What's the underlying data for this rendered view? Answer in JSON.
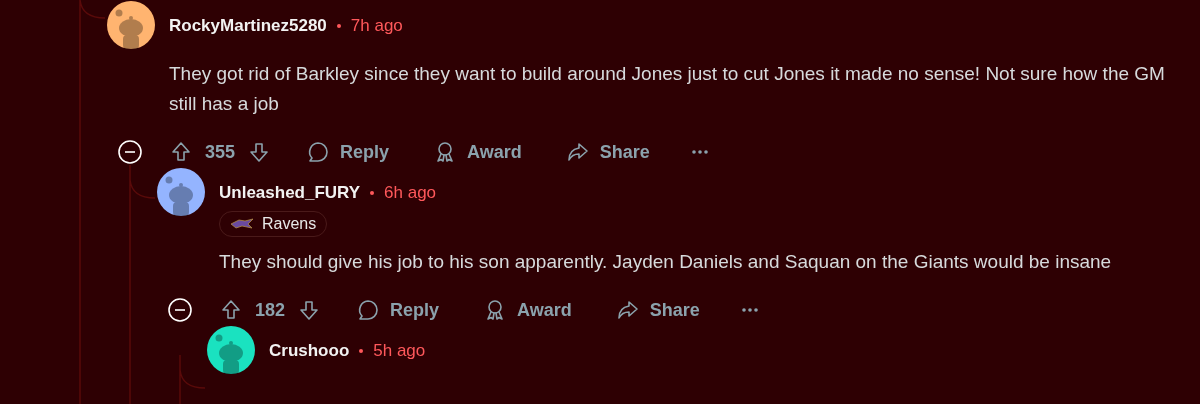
{
  "comments": [
    {
      "author": "RockyMartinez5280",
      "time": "7h ago",
      "color": "#ffb470",
      "body": "They got rid of Barkley since they want to build around Jones just to cut Jones it made no sense! Not sure how the GM still has a job",
      "score": "355",
      "actions": [
        "Reply",
        "Award",
        "Share"
      ],
      "children": [
        {
          "author": "Unleashed_FURY",
          "time": "6h ago",
          "color": "#94b4ff",
          "flair": "Ravens",
          "body": "They should give his job to his son apparently. Jayden Daniels and Saquan on the Giants would be insane",
          "score": "182",
          "actions": [
            "Reply",
            "Award",
            "Share"
          ],
          "children": [
            {
              "author": "Crushooo",
              "time": "5h ago",
              "color": "#1ae2c0"
            }
          ]
        }
      ]
    }
  ]
}
